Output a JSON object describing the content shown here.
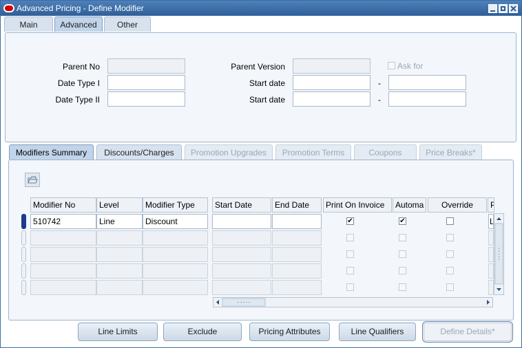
{
  "window": {
    "title": "Advanced Pricing - Define Modifier"
  },
  "top_tabs": [
    {
      "label": "Main"
    },
    {
      "label": "Advanced"
    },
    {
      "label": "Other"
    }
  ],
  "header": {
    "parent_no_label": "Parent No",
    "parent_version_label": "Parent Version",
    "ask_for_label": "Ask for",
    "date_type_1_label": "Date Type I",
    "date_type_2_label": "Date Type II",
    "start_date_label_1": "Start date",
    "start_date_label_2": "Start date",
    "dash_1": "-",
    "dash_2": "-"
  },
  "lower_tabs": [
    {
      "label": "Modifiers Summary"
    },
    {
      "label": "Discounts/Charges"
    },
    {
      "label": "Promotion Upgrades"
    },
    {
      "label": "Promotion Terms"
    },
    {
      "label": "Coupons"
    },
    {
      "label": "Price Breaks*"
    }
  ],
  "table": {
    "columns": [
      "Modifier No",
      "Level",
      "Modifier Type",
      "Start Date",
      "End Date",
      "Print On Invoice",
      "Automa",
      "Override",
      "P"
    ],
    "rows": [
      {
        "modifier_no": "510742",
        "level": "Line",
        "modifier_type": "Discount",
        "start_date": "",
        "end_date": "",
        "print_on_invoice": true,
        "automatic": true,
        "override": false,
        "p": "L"
      }
    ]
  },
  "buttons": {
    "line_limits": "Line Limits",
    "exclude": "Exclude",
    "pricing_attributes": "Pricing Attributes",
    "line_qualifiers": "Line Qualifiers",
    "define_details": "Define Details*"
  },
  "colors": {
    "titlebar": "#3c6ea7",
    "panel_border": "#9db4cf",
    "current_row": "#1e3a8a"
  }
}
